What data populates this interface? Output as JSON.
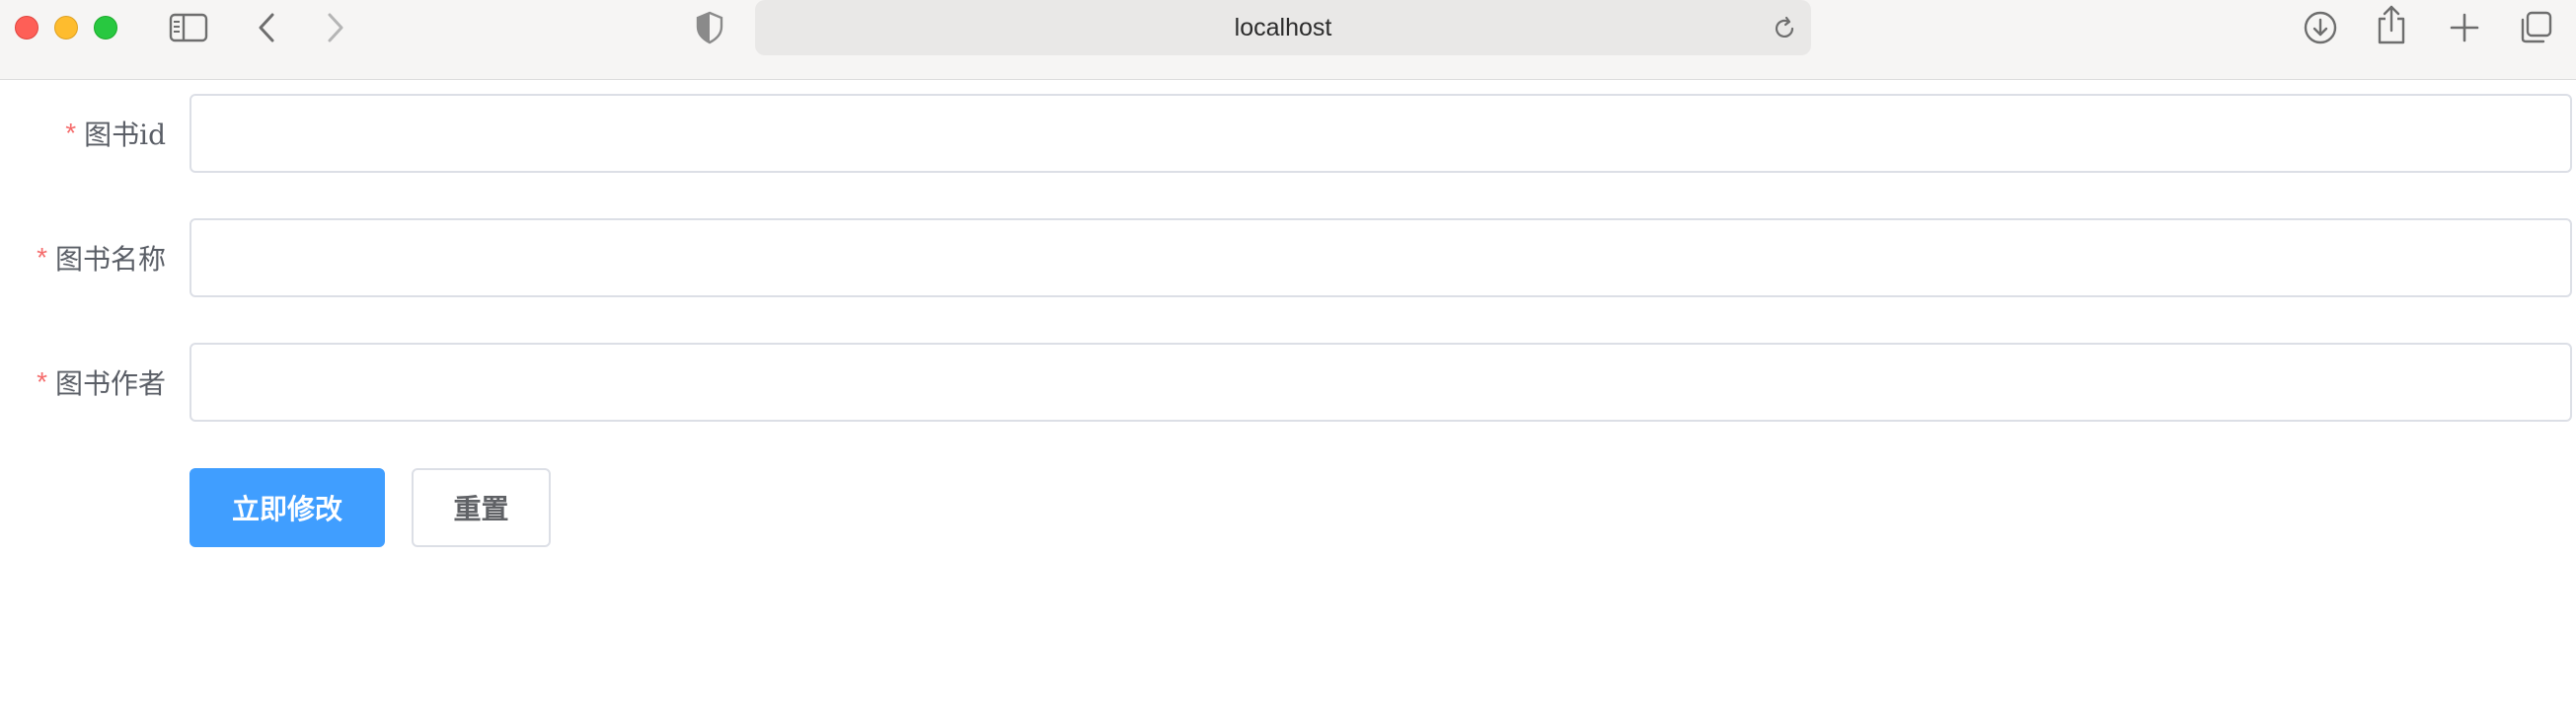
{
  "browser": {
    "url": "localhost",
    "icons": {
      "sidebar": "sidebar-icon",
      "back": "chevron-left-icon",
      "forward": "chevron-right-icon",
      "privacy": "shield-icon",
      "reload": "reload-icon",
      "downloads": "download-icon",
      "share": "share-icon",
      "new_tab": "plus-icon",
      "tab_overview": "tabs-icon"
    }
  },
  "form": {
    "required_mark": "*",
    "fields": [
      {
        "label": "图书id",
        "value": "",
        "placeholder": ""
      },
      {
        "label": "图书名称",
        "value": "",
        "placeholder": ""
      },
      {
        "label": "图书作者",
        "value": "",
        "placeholder": ""
      }
    ],
    "buttons": {
      "submit": "立即修改",
      "reset": "重置"
    }
  },
  "colors": {
    "primary": "#409eff",
    "required": "#f56c6c",
    "border": "#dcdfe6",
    "label": "#5a5e66"
  }
}
